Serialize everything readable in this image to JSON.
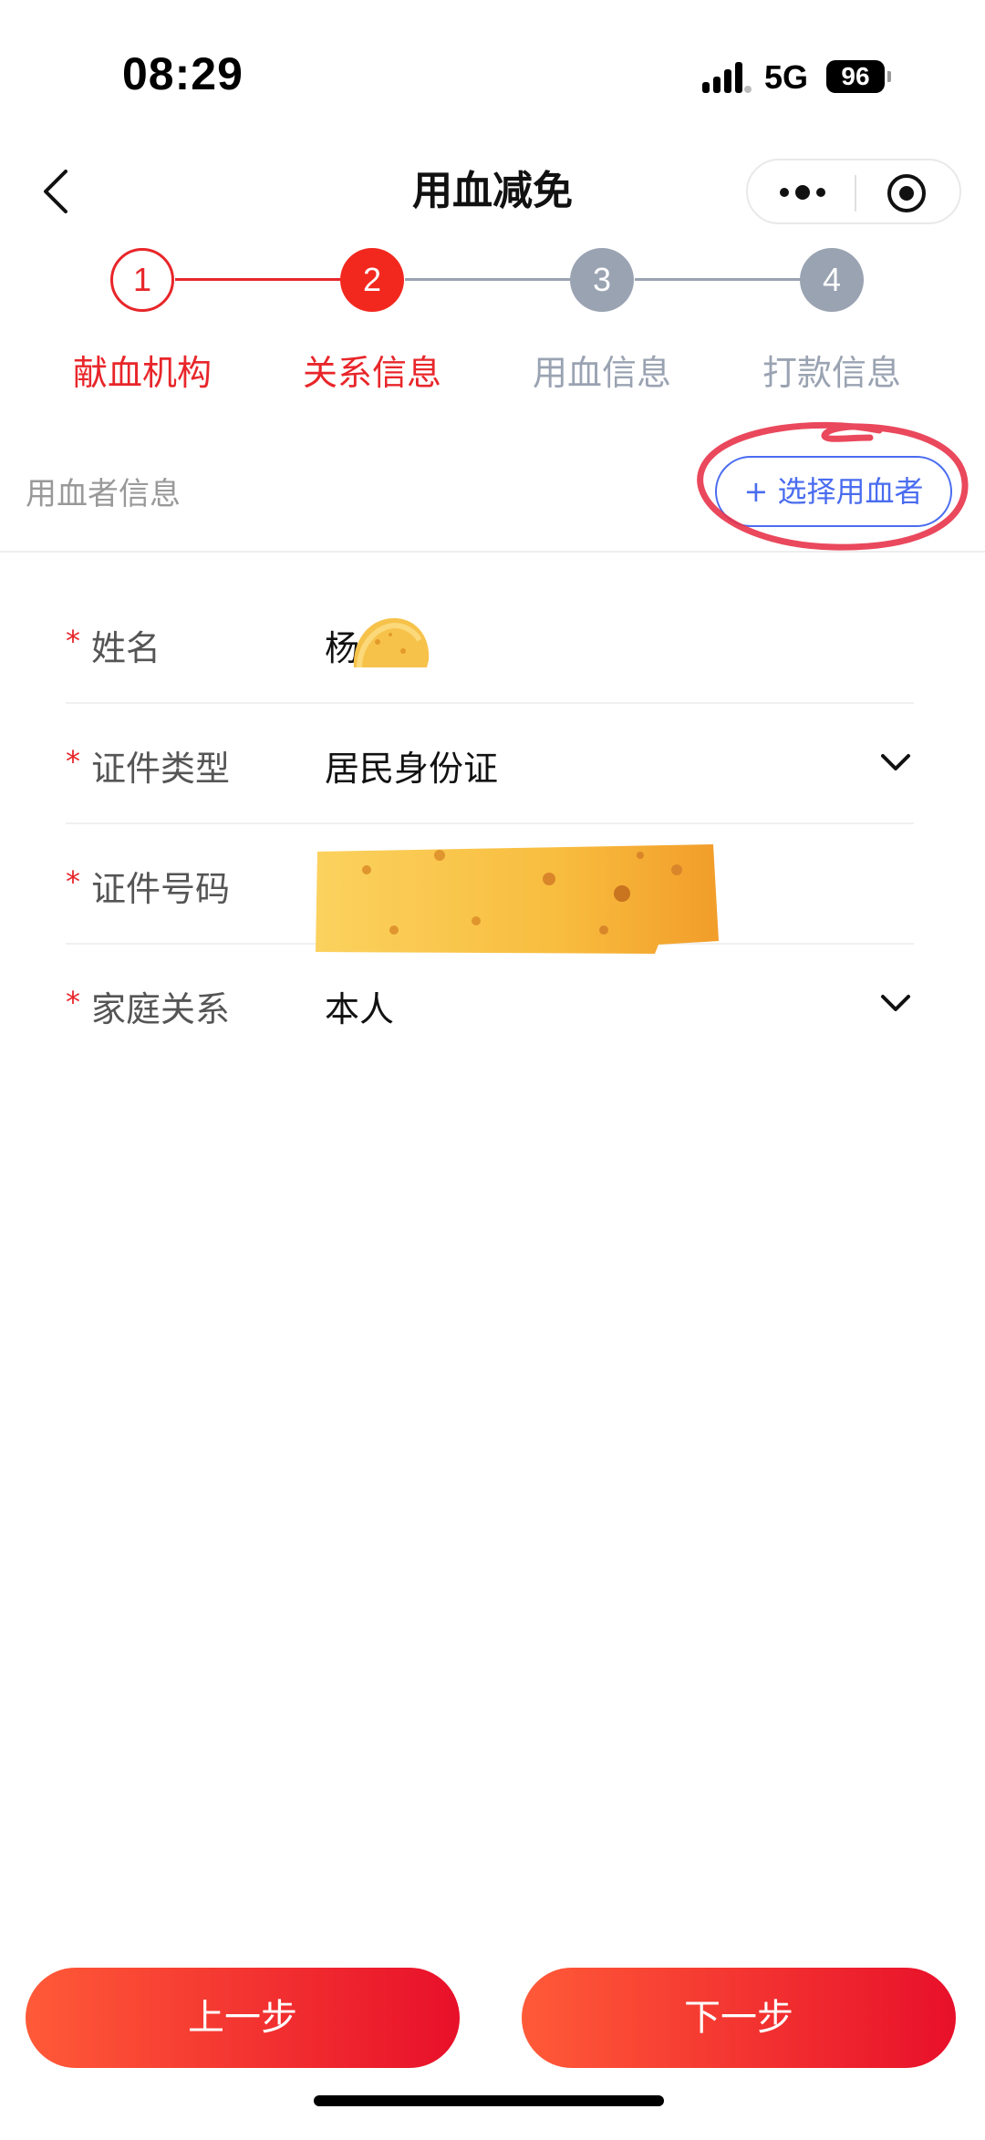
{
  "status_bar": {
    "time": "08:29",
    "network": "5G",
    "battery": "96"
  },
  "nav": {
    "title": "用血减免",
    "icons": [
      "back-icon",
      "more-icon",
      "target-icon"
    ]
  },
  "stepper": {
    "steps": [
      {
        "number": "1",
        "label": "献血机构",
        "state": "done"
      },
      {
        "number": "2",
        "label": "关系信息",
        "state": "active"
      },
      {
        "number": "3",
        "label": "用血信息",
        "state": "pending"
      },
      {
        "number": "4",
        "label": "打款信息",
        "state": "pending"
      }
    ]
  },
  "section": {
    "title": "用血者信息",
    "select_button": "+ 选择用血者"
  },
  "form": {
    "rows": [
      {
        "label": "姓名",
        "value": "杨",
        "dropdown": false
      },
      {
        "label": "证件类型",
        "value": "居民身份证",
        "dropdown": true
      },
      {
        "label": "证件号码",
        "value": "",
        "dropdown": false
      },
      {
        "label": "家庭关系",
        "value": "本人",
        "dropdown": true
      }
    ]
  },
  "footer": {
    "prev_label": "上一步",
    "next_label": "下一步"
  },
  "colors": {
    "accent_red": "#e8262a",
    "pending_gray": "#9aa3b2",
    "link_blue": "#4a6cf0"
  }
}
